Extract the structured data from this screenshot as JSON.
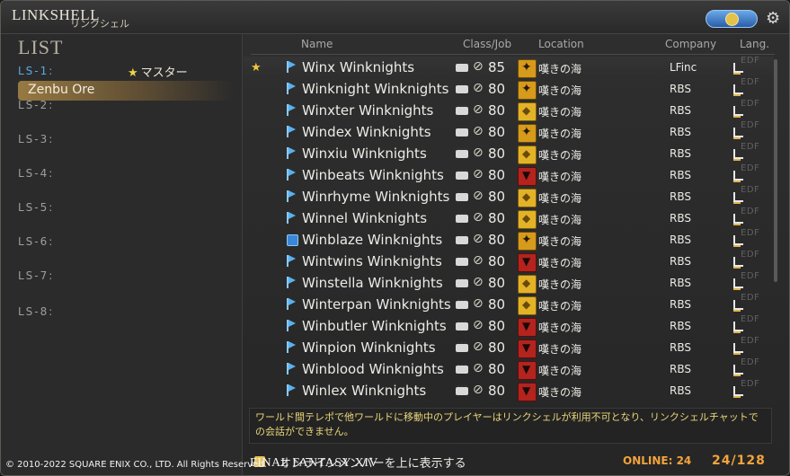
{
  "window": {
    "title": "LINKSHELL",
    "subtitle": "リンクシェル"
  },
  "sidebar": {
    "heading": "LIST",
    "items": [
      {
        "label": "LS-1:",
        "active": true,
        "master": "マスター",
        "name": "Zenbu Ore"
      },
      {
        "label": "LS-2:"
      },
      {
        "label": "LS-3:"
      },
      {
        "label": "LS-4:"
      },
      {
        "label": "LS-5:"
      },
      {
        "label": "LS-6:"
      },
      {
        "label": "LS-7:"
      },
      {
        "label": "LS-8:"
      }
    ]
  },
  "table": {
    "headers": {
      "name": "Name",
      "class": "Class/Job",
      "location": "Location",
      "company": "Company",
      "lang": "Lang."
    },
    "rows": [
      {
        "name": "Winx Winknights",
        "level": "85",
        "gc": "flames",
        "location": "嘆きの海",
        "company": "LFinc",
        "leader": true,
        "lang": "EDF"
      },
      {
        "name": "Winknight Winknights",
        "level": "80",
        "gc": "flames",
        "location": "嘆きの海",
        "company": "RBS",
        "lang": "EDF"
      },
      {
        "name": "Winxter Winknights",
        "level": "80",
        "gc": "adders",
        "location": "嘆きの海",
        "company": "RBS",
        "lang": "EDF"
      },
      {
        "name": "Windex Winknights",
        "level": "80",
        "gc": "flames",
        "location": "嘆きの海",
        "company": "RBS",
        "lang": "EDF"
      },
      {
        "name": "Winxiu Winknights",
        "level": "80",
        "gc": "adders",
        "location": "嘆きの海",
        "company": "RBS",
        "lang": "EDF"
      },
      {
        "name": "Winbeats Winknights",
        "level": "80",
        "gc": "maelstrom",
        "location": "嘆きの海",
        "company": "RBS",
        "lang": "EDF"
      },
      {
        "name": "Winrhyme Winknights",
        "level": "80",
        "gc": "adders",
        "location": "嘆きの海",
        "company": "RBS",
        "lang": "EDF"
      },
      {
        "name": "Winnel Winknights",
        "level": "80",
        "gc": "adders",
        "location": "嘆きの海",
        "company": "RBS",
        "lang": "EDF"
      },
      {
        "name": "Winblaze Winknights",
        "level": "80",
        "gc": "flames",
        "location": "嘆きの海",
        "company": "RBS",
        "leaderFlag": true,
        "lang": "EDF"
      },
      {
        "name": "Wintwins Winknights",
        "level": "80",
        "gc": "maelstrom",
        "location": "嘆きの海",
        "company": "RBS",
        "lang": "EDF"
      },
      {
        "name": "Winstella Winknights",
        "level": "80",
        "gc": "adders",
        "location": "嘆きの海",
        "company": "RBS",
        "lang": "EDF"
      },
      {
        "name": "Winterpan Winknights",
        "level": "80",
        "gc": "adders",
        "location": "嘆きの海",
        "company": "RBS",
        "lang": "EDF"
      },
      {
        "name": "Winbutler Winknights",
        "level": "80",
        "gc": "maelstrom",
        "location": "嘆きの海",
        "company": "RBS",
        "lang": "EDF"
      },
      {
        "name": "Winpion Winknights",
        "level": "80",
        "gc": "maelstrom",
        "location": "嘆きの海",
        "company": "RBS",
        "lang": "EDF"
      },
      {
        "name": "Winblood Winknights",
        "level": "80",
        "gc": "maelstrom",
        "location": "嘆きの海",
        "company": "RBS",
        "lang": "EDF"
      },
      {
        "name": "Winlex Winknights",
        "level": "80",
        "gc": "maelstrom",
        "location": "嘆きの海",
        "company": "RBS",
        "lang": "EDF"
      }
    ]
  },
  "notice": "ワールド間テレポで他ワールドに移動中のプレイヤーはリンクシェルが利用不可となり、リンクシェルチャットでの会話ができません。",
  "footer": {
    "checkbox_label": "オンラインメンバーを上に表示する",
    "online": "ONLINE: 24",
    "count": "24/128"
  },
  "copyright": "© 2010-2022 SQUARE ENIX CO., LTD. All Rights Reserved.",
  "game_title": "FINAL FANTASY XIV"
}
